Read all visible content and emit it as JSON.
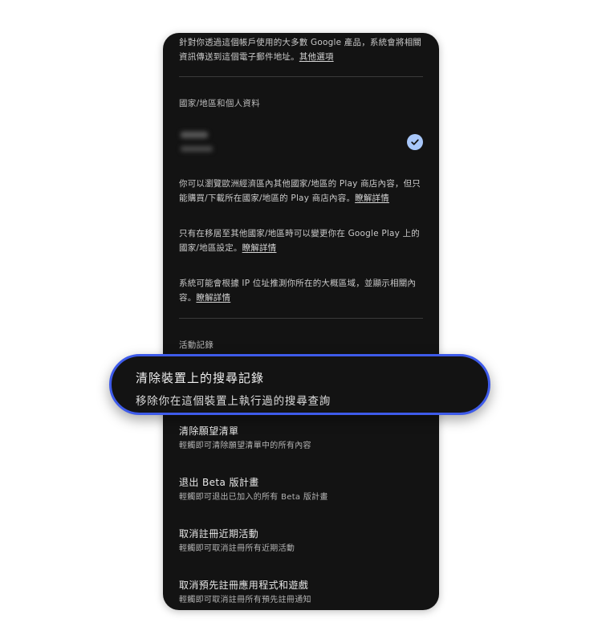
{
  "intro": {
    "text": "針對你透過這個帳戶使用的大多數 Google 產品，系統會將相關資訊傳送到這個電子郵件地址。",
    "link": "其他選項"
  },
  "region_section": {
    "title": "國家/地區和個人資料",
    "eea_text": "你可以瀏覽歐洲經濟區內其他國家/地區的 Play 商店內容，但只能購買/下載所在國家/地區的 Play 商店內容。",
    "eea_link": "瞭解詳情",
    "move_text": "只有在移居至其他國家/地區時可以變更你在 Google Play 上的國家/地區設定。",
    "move_link": "瞭解詳情",
    "ip_text": "系統可能會根據 IP 位址推測你所在的大概區域，並顯示相關內容。",
    "ip_link": "瞭解詳情"
  },
  "activity_section": {
    "title": "活動記錄"
  },
  "highlighted_item": {
    "title": "清除裝置上的搜尋記錄",
    "subtitle": "移除你在這個裝置上執行過的搜尋查詢"
  },
  "items": [
    {
      "title": "清除願望清單",
      "subtitle": "輕觸即可清除願望清單中的所有內容"
    },
    {
      "title": "退出 Beta 版計畫",
      "subtitle": "輕觸即可退出已加入的所有 Beta 版計畫"
    },
    {
      "title": "取消註冊近期活動",
      "subtitle": "輕觸即可取消註冊所有近期活動"
    },
    {
      "title": "取消預先註冊應用程式和遊戲",
      "subtitle": "輕觸即可取消註冊所有預先註冊通知"
    }
  ],
  "colors": {
    "background": "#131313",
    "accent_border": "#3e5bea",
    "check": "#a8c7fa"
  },
  "icons": {
    "check": "check-circle-icon"
  }
}
